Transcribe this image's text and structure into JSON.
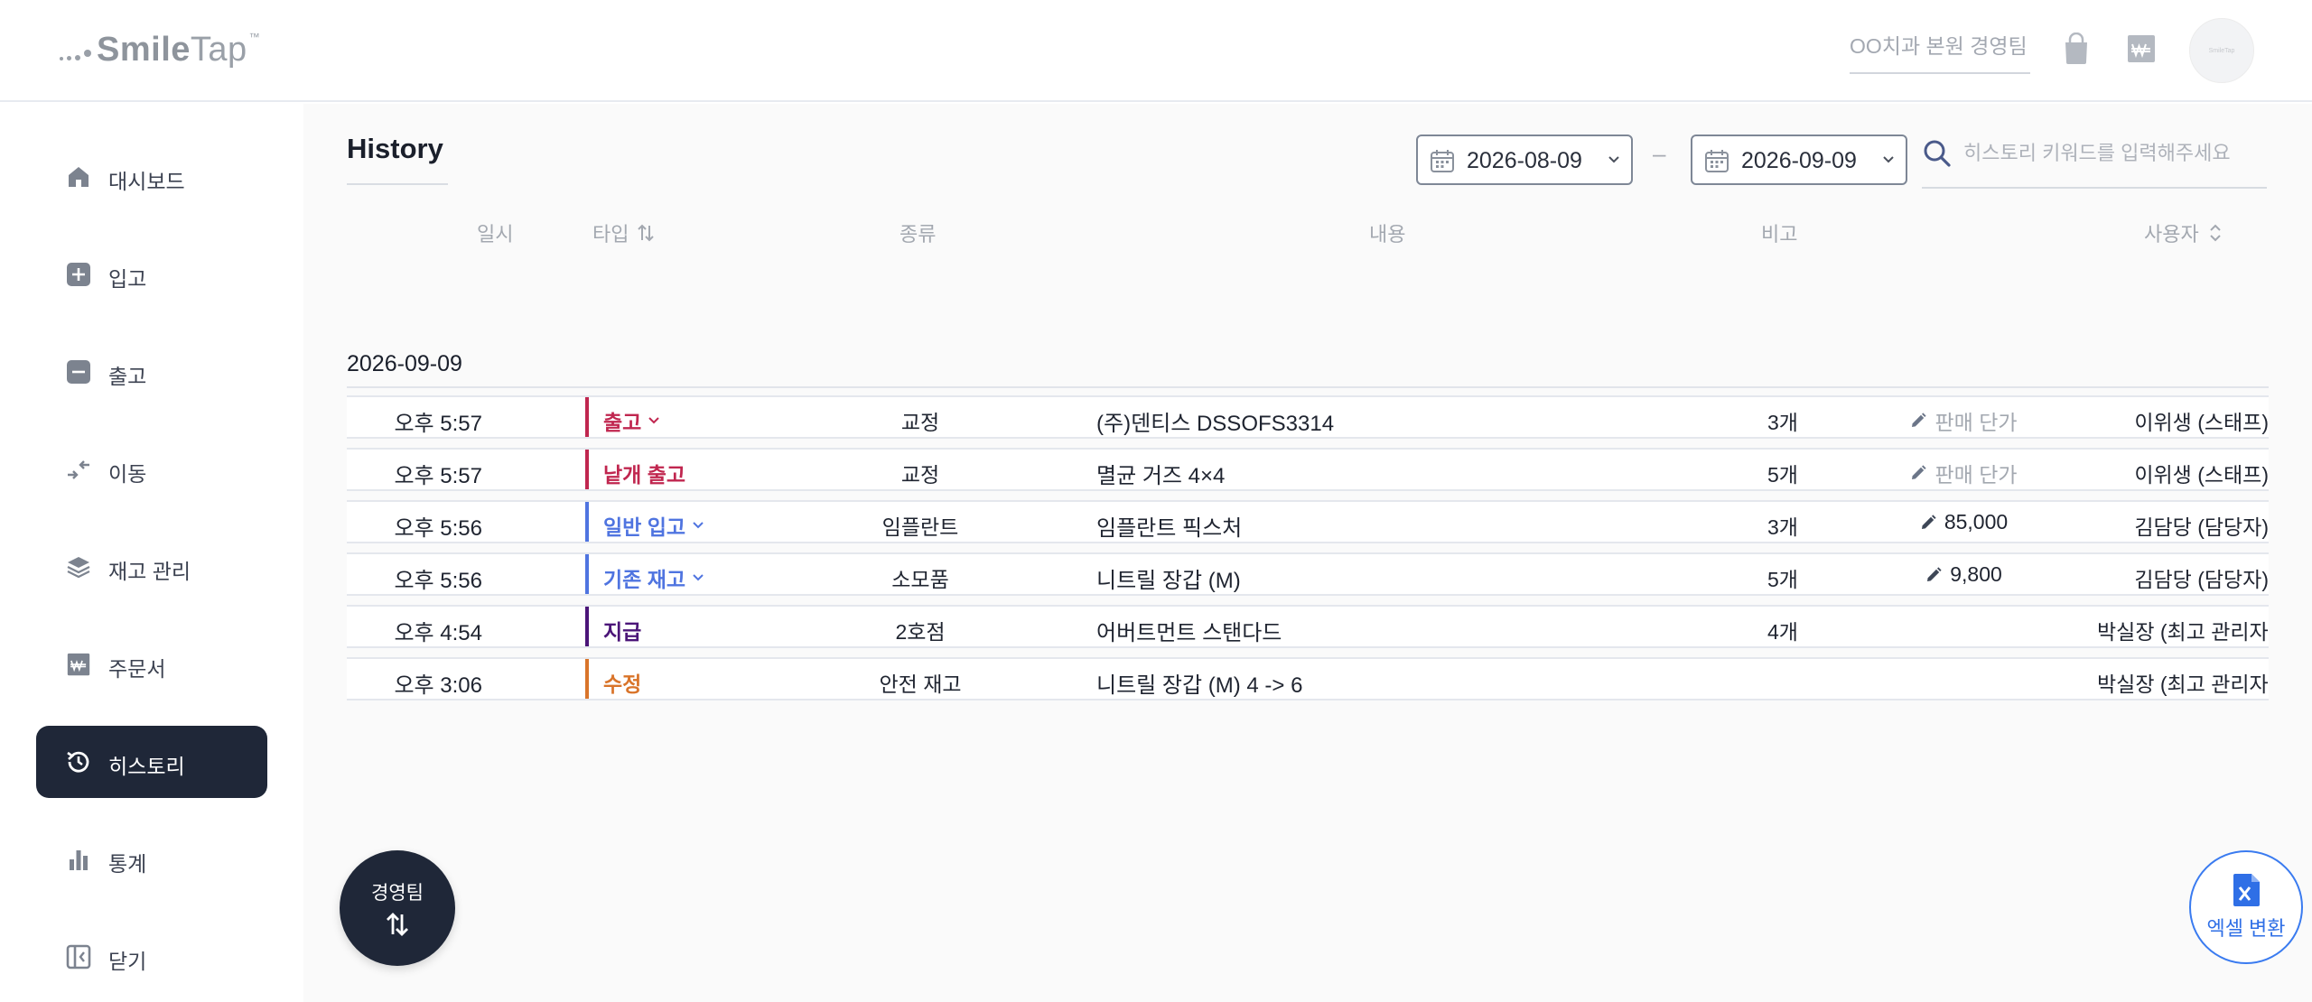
{
  "header": {
    "logo_main": "Smile",
    "logo_sub": "Tap",
    "logo_tm": "™",
    "clinic_name": "OO치과 본원 경영팀",
    "icons": [
      "shopping-bag-icon",
      "won-order-icon"
    ]
  },
  "sidebar": {
    "items": [
      {
        "label": "대시보드",
        "icon": "home-icon",
        "active": false
      },
      {
        "label": "입고",
        "icon": "plus-square-icon",
        "active": false
      },
      {
        "label": "출고",
        "icon": "minus-square-icon",
        "active": false
      },
      {
        "label": "이동",
        "icon": "move-arrows-icon",
        "active": false
      },
      {
        "label": "재고 관리",
        "icon": "layers-icon",
        "active": false
      },
      {
        "label": "주문서",
        "icon": "won-order-icon",
        "active": false
      },
      {
        "label": "히스토리",
        "icon": "history-icon",
        "active": true
      },
      {
        "label": "통계",
        "icon": "bar-chart-icon",
        "active": false
      },
      {
        "label": "닫기",
        "icon": "collapse-sidebar-icon",
        "active": false
      }
    ]
  },
  "main": {
    "title": "History",
    "date_from": "2026-08-09",
    "date_to": "2026-09-09",
    "date_separator": "–",
    "search_placeholder": "히스토리 키워드를 입력해주세요",
    "columns": {
      "datetime": "일시",
      "type": "타입",
      "category": "종류",
      "content": "내용",
      "note": "비고",
      "user": "사용자"
    },
    "group_date": "2026-09-09",
    "rows": [
      {
        "time": "오후 5:57",
        "type": "출고",
        "type_color": "#c0264f",
        "has_dropdown": true,
        "category": "교정",
        "content": "(주)덴티스 DSSOFS3314",
        "qty": "3개",
        "note": "판매 단가",
        "note_muted": true,
        "has_pencil": true,
        "user": "이위생 (스태프)"
      },
      {
        "time": "오후 5:57",
        "type": "낱개 출고",
        "type_color": "#c0264f",
        "has_dropdown": false,
        "category": "교정",
        "content": "멸균 거즈 4×4",
        "qty": "5개",
        "note": "판매 단가",
        "note_muted": true,
        "has_pencil": true,
        "user": "이위생 (스태프)"
      },
      {
        "time": "오후 5:56",
        "type": "일반 입고",
        "type_color": "#4f74e0",
        "has_dropdown": true,
        "category": "임플란트",
        "content": "임플란트 픽스처",
        "qty": "3개",
        "note": "85,000",
        "note_muted": false,
        "has_pencil": true,
        "user": "김담당 (담당자)"
      },
      {
        "time": "오후 5:56",
        "type": "기존 재고",
        "type_color": "#4f74e0",
        "has_dropdown": true,
        "category": "소모품",
        "content": "니트릴 장갑 (M)",
        "qty": "5개",
        "note": "9,800",
        "note_muted": false,
        "has_pencil": true,
        "user": "김담당 (담당자)"
      },
      {
        "time": "오후 4:54",
        "type": "지급",
        "type_color": "#4b1578",
        "has_dropdown": false,
        "category": "2호점",
        "content": "어버트먼트 스탠다드",
        "qty": "4개",
        "note": "",
        "note_muted": false,
        "has_pencil": false,
        "user": "박실장 (최고 관리자)"
      },
      {
        "time": "오후 3:06",
        "type": "수정",
        "type_color": "#d9742a",
        "has_dropdown": false,
        "category": "안전 재고",
        "content": "니트릴 장갑 (M) 4 -> 6",
        "qty": "",
        "note": "",
        "note_muted": false,
        "has_pencil": false,
        "user": "박실장 (최고 관리자)"
      }
    ]
  },
  "fab": {
    "team_label": "경영팀",
    "excel_label": "엑셀 변환"
  },
  "colors": {
    "sidebar_active_bg": "#1f2738",
    "accent_blue": "#2f6fe6",
    "out_red": "#c0264f",
    "in_blue": "#4f74e0",
    "give_purple": "#4b1578",
    "edit_orange": "#d9742a"
  }
}
